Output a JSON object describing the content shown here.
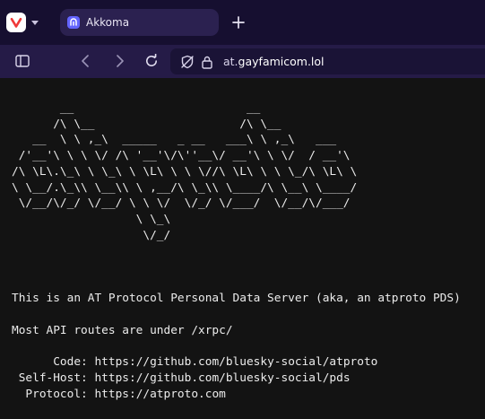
{
  "tabs": [
    {
      "title": "Akkoma",
      "favicon": "akkoma-icon",
      "active": true
    }
  ],
  "address_bar": {
    "prefix": "at.",
    "domain": "gayfamicom.lol",
    "secure": true
  },
  "icons": {
    "browser_menu": "vivaldi-logo-icon",
    "new_tab": "plus-icon",
    "panel_toggle": "sidebar-panel-icon",
    "back": "chevron-left-icon",
    "forward": "chevron-right-icon",
    "reload": "reload-icon",
    "tracker_blocker": "shield-slash-icon",
    "lock": "lock-icon"
  },
  "colors": {
    "tab_strip": "#160f30",
    "active_tab": "#2b2150",
    "toolbar": "#251b47",
    "address_field": "#1a1336",
    "page_background": "#131313",
    "page_text": "#ececec"
  },
  "page": {
    "ascii_banner": "       __                         __\n      /\\ \\__                     /\\ \\__\n   __  \\ \\ ,_\\  _____   _ __   ___\\ \\ ,_\\   ___\n /'__'\\ \\ \\ \\/ /\\ '__'\\/\\''__\\/ __'\\ \\ \\/  / __'\\\n/\\ \\L\\.\\_\\ \\ \\_\\ \\ \\L\\ \\ \\ \\//\\ \\L\\ \\ \\ \\_/\\ \\L\\ \\\n\\ \\__/.\\_\\\\ \\__\\\\ \\ ,__/\\ \\_\\\\ \\____/\\ \\__\\ \\____/\n \\/__/\\/_/ \\/__/ \\ \\ \\/  \\/_/ \\/___/  \\/__/\\/___/\n                  \\ \\_\\\n                   \\/_/",
    "intro": "This is an AT Protocol Personal Data Server (aka, an atproto PDS)",
    "routes_note": "Most API routes are under /xrpc/",
    "links": [
      {
        "label": "      Code:",
        "url": "https://github.com/bluesky-social/atproto"
      },
      {
        "label": " Self-Host:",
        "url": "https://github.com/bluesky-social/pds"
      },
      {
        "label": "  Protocol:",
        "url": "https://atproto.com"
      }
    ]
  }
}
